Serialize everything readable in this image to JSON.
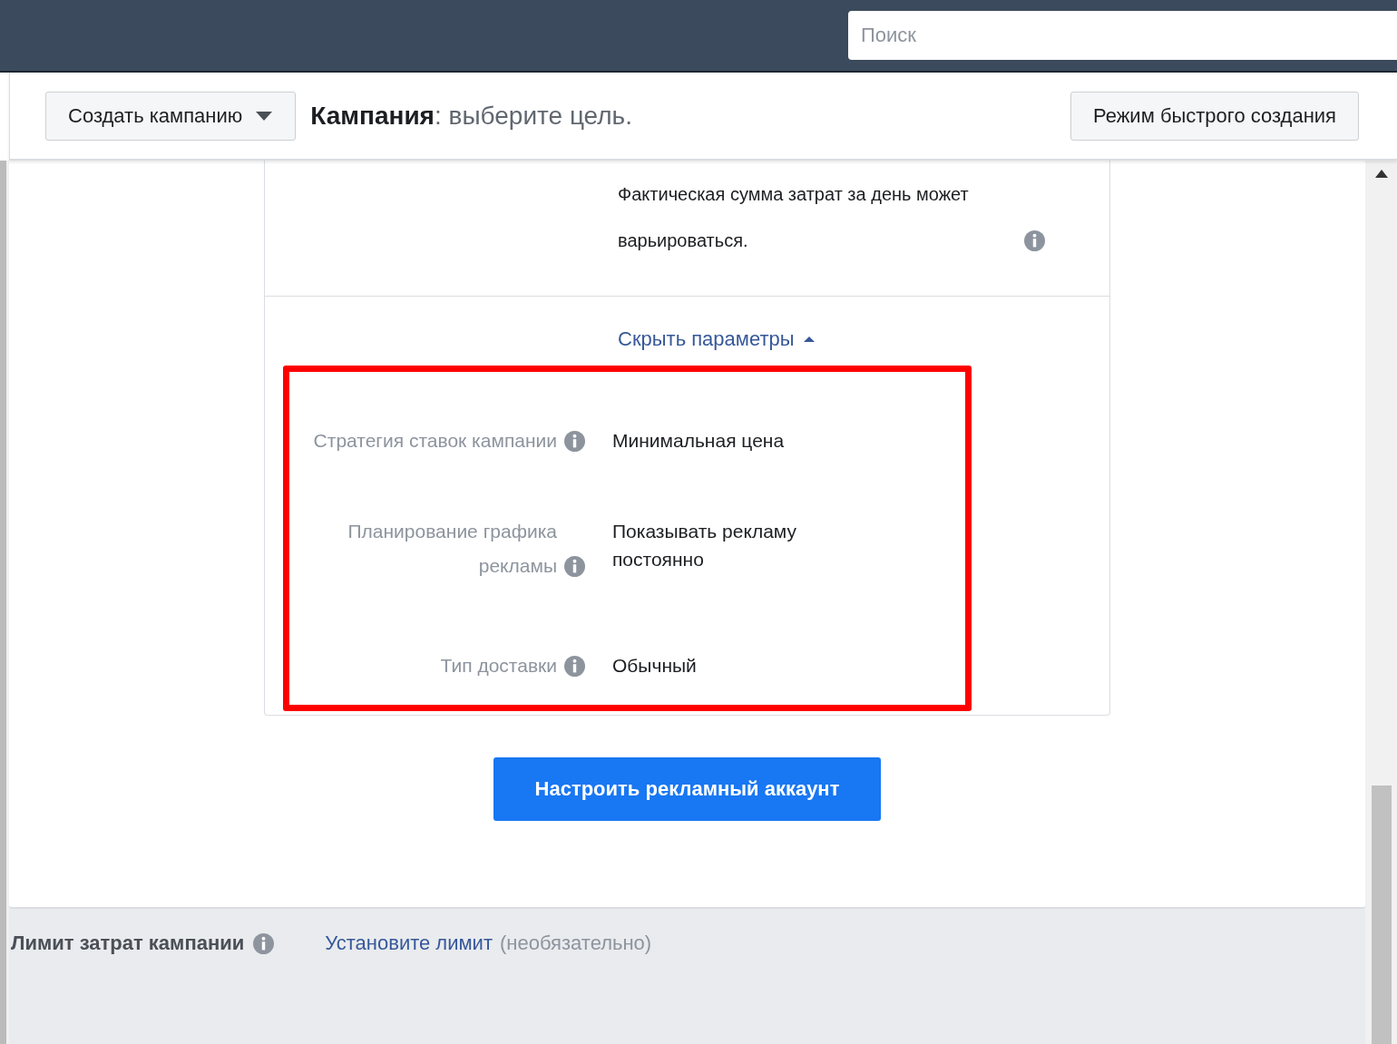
{
  "search": {
    "placeholder": "Поиск"
  },
  "header": {
    "create_button": "Создать кампанию",
    "title_bold": "Кампания",
    "title_rest": ": выберите цель.",
    "quick_mode_button": "Режим быстрого создания"
  },
  "budget_note": "Фактическая сумма затрат за день может варьироваться.",
  "toggle_link": "Скрыть параметры",
  "settings": [
    {
      "label": "Стратегия ставок кампании",
      "value": "Минимальная цена"
    },
    {
      "label": "Планирование графика рекламы",
      "value": "Показывать рекламу постоянно"
    },
    {
      "label": "Тип доставки",
      "value": "Обычный"
    }
  ],
  "primary_button": "Настроить рекламный аккаунт",
  "spend_limit": {
    "label": "Лимит затрат кампании",
    "link": "Установите лимит",
    "hint": "(необязательно)"
  }
}
